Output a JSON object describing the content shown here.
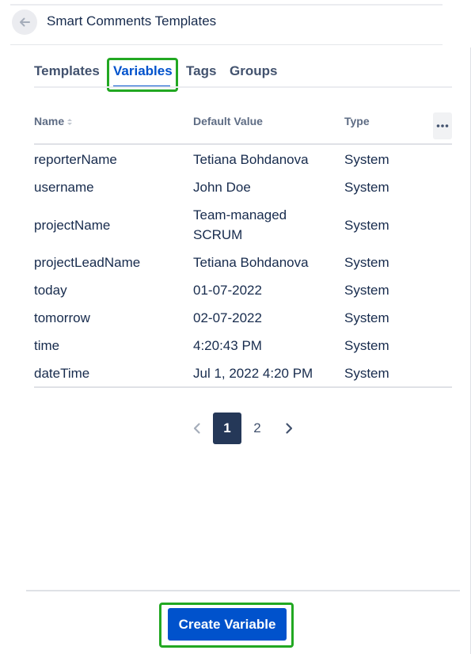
{
  "header": {
    "title": "Smart Comments Templates",
    "back_icon": "arrow-left-icon"
  },
  "tabs": [
    {
      "label": "Templates",
      "active": false
    },
    {
      "label": "Variables",
      "active": true
    },
    {
      "label": "Tags",
      "active": false
    },
    {
      "label": "Groups",
      "active": false
    }
  ],
  "table": {
    "columns": [
      "Name",
      "Default Value",
      "Type"
    ],
    "more_icon": "more-horizontal-icon",
    "sort_icon": "sort-icon",
    "rows": [
      {
        "name": "reporterName",
        "default_value": "Tetiana Bohdanova",
        "type": "System"
      },
      {
        "name": "username",
        "default_value": "John Doe",
        "type": "System"
      },
      {
        "name": "projectName",
        "default_value": "Team-managed SCRUM",
        "type": "System"
      },
      {
        "name": "projectLeadName",
        "default_value": "Tetiana Bohdanova",
        "type": "System"
      },
      {
        "name": "today",
        "default_value": "01-07-2022",
        "type": "System"
      },
      {
        "name": "tomorrow",
        "default_value": "02-07-2022",
        "type": "System"
      },
      {
        "name": "time",
        "default_value": "4:20:43 PM",
        "type": "System"
      },
      {
        "name": "dateTime",
        "default_value": "Jul 1, 2022 4:20 PM",
        "type": "System"
      }
    ]
  },
  "pagination": {
    "pages": [
      "1",
      "2"
    ],
    "current": "1",
    "prev_icon": "chevron-left-icon",
    "next_icon": "chevron-right-icon"
  },
  "footer": {
    "create_label": "Create Variable"
  },
  "colors": {
    "accent": "#0052cc",
    "highlight": "#22a822",
    "current_page": "#253858"
  }
}
